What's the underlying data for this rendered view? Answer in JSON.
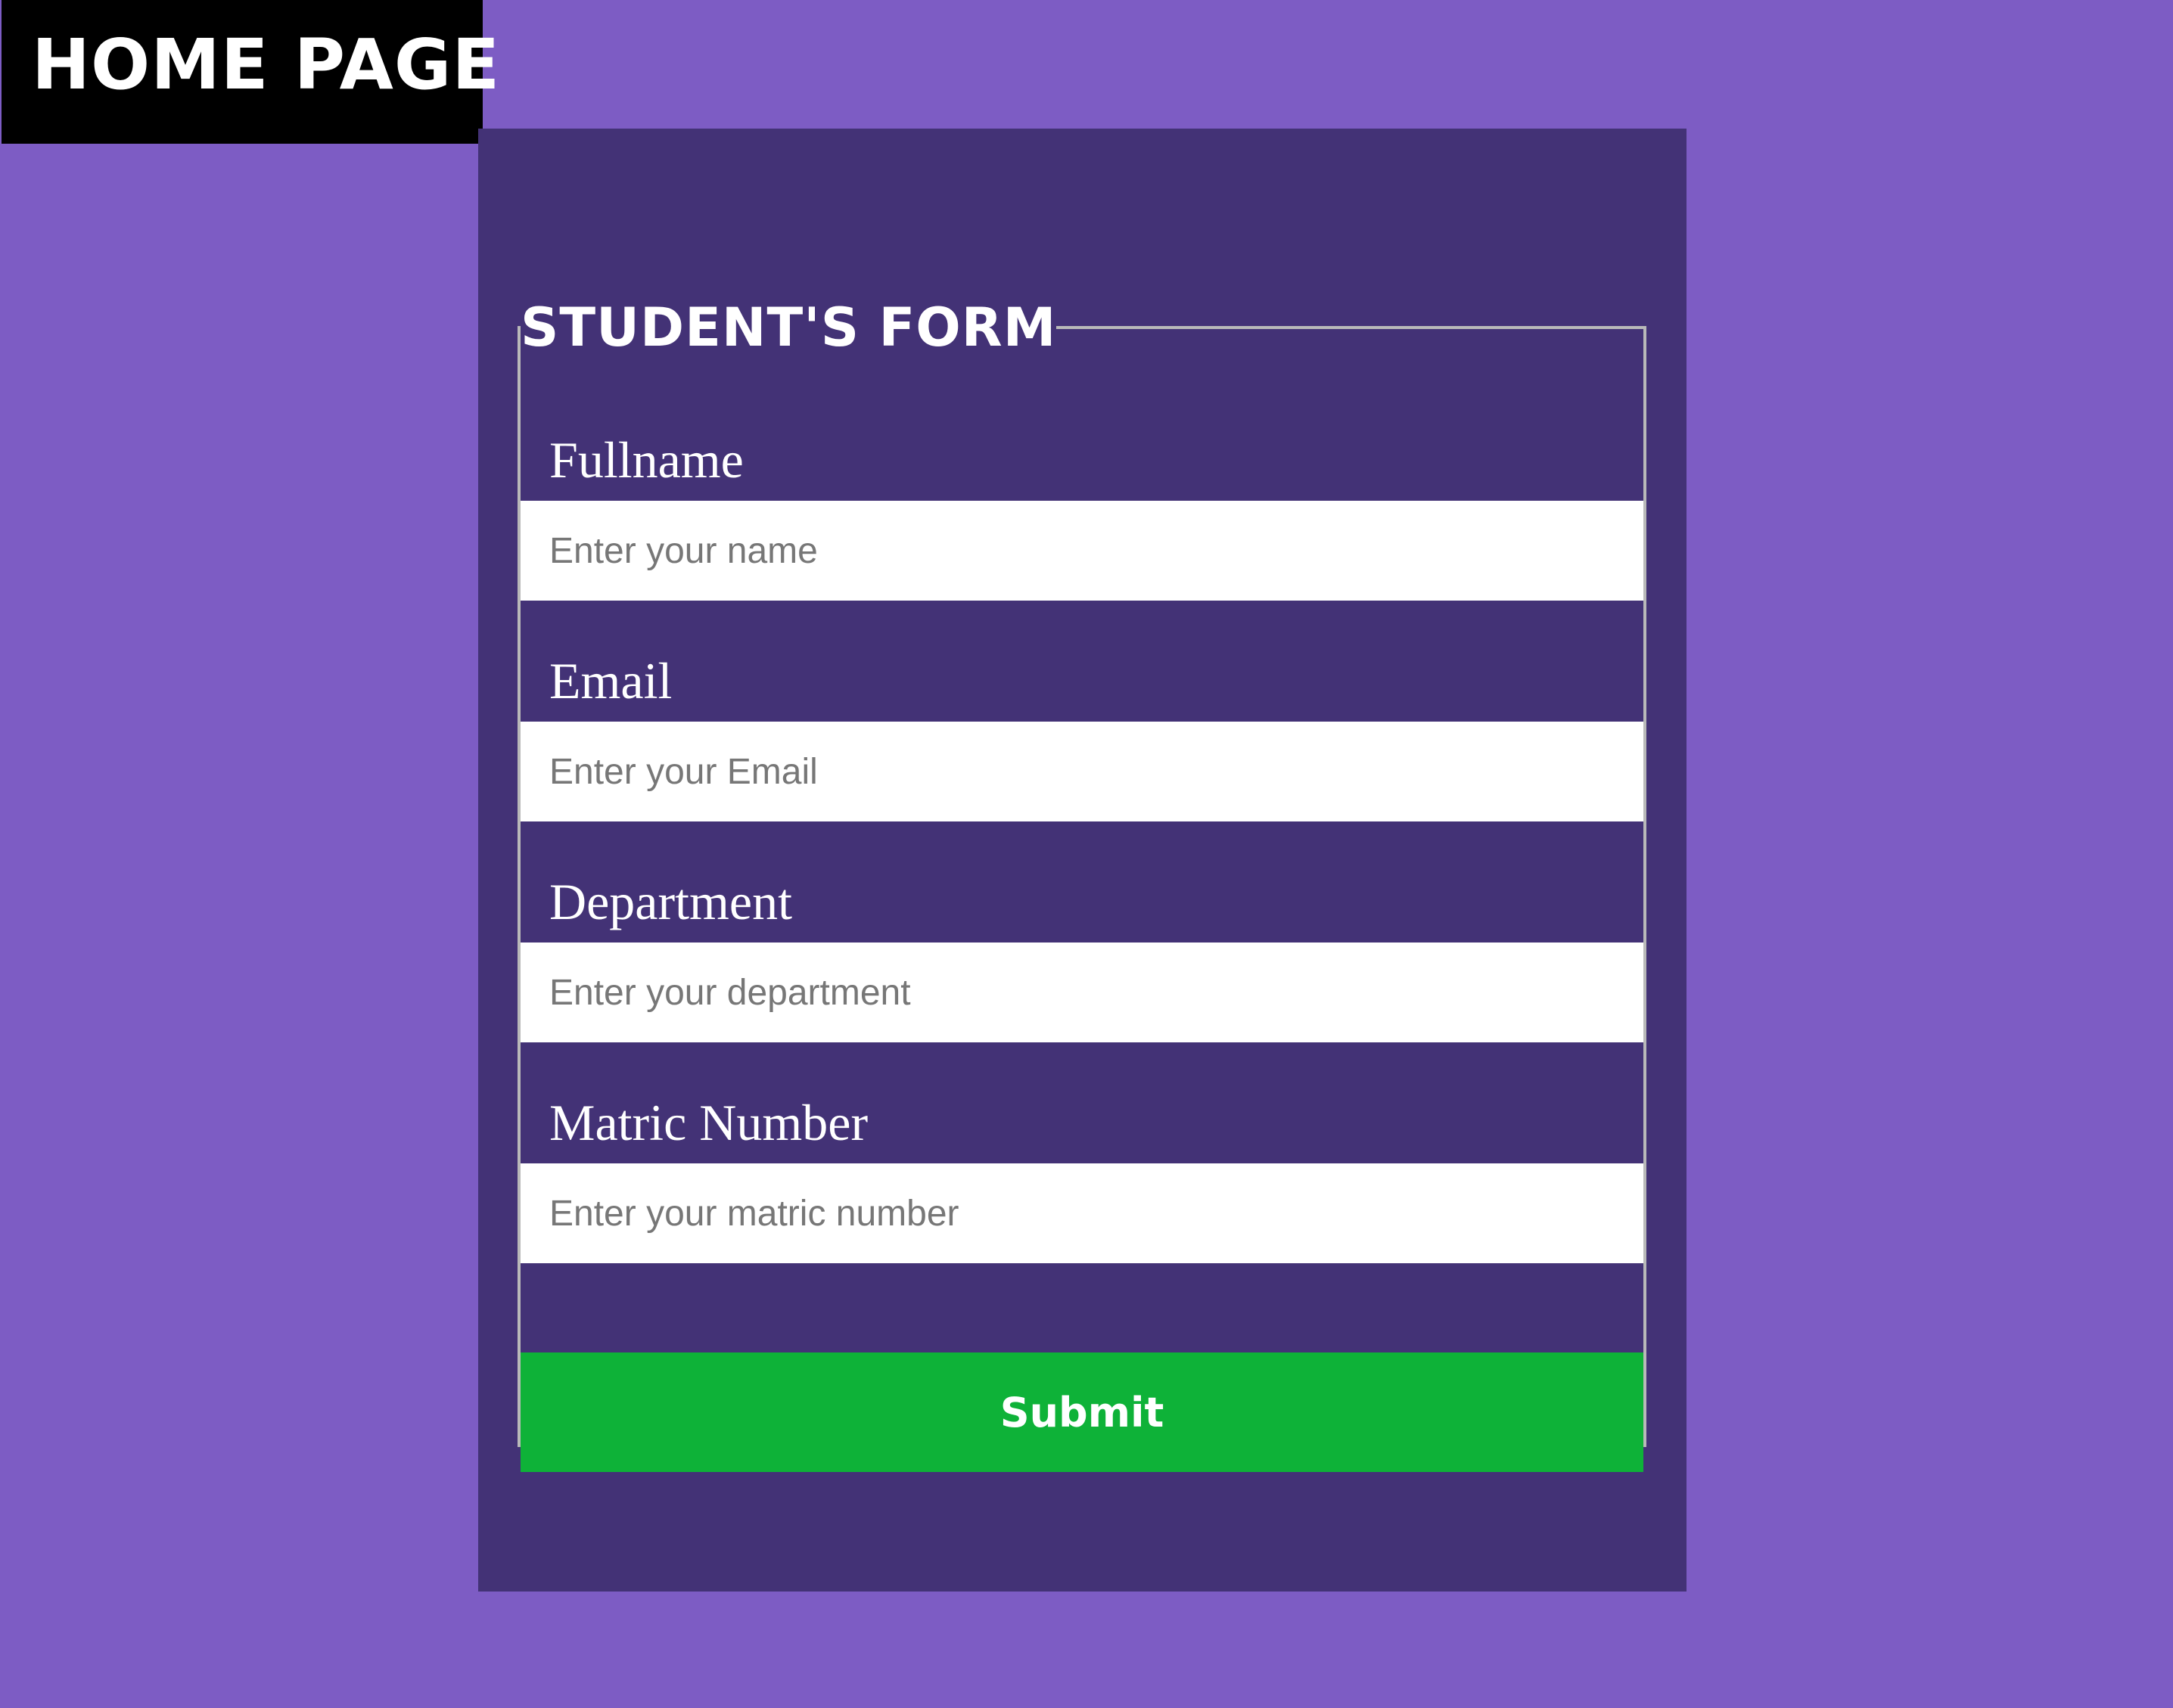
{
  "header": {
    "home_label": "HOME PAGE"
  },
  "form": {
    "title": "STUDENT'S FORM",
    "fields": [
      {
        "label": "Fullname",
        "placeholder": "Enter your name",
        "value": ""
      },
      {
        "label": "Email",
        "placeholder": "Enter your Email",
        "value": ""
      },
      {
        "label": "Department",
        "placeholder": "Enter your department",
        "value": ""
      },
      {
        "label": "Matric Number",
        "placeholder": "Enter your matric number",
        "value": ""
      }
    ],
    "submit_label": "Submit"
  },
  "colors": {
    "page_background": "#7d5cc4",
    "panel_background": "#433276",
    "header_background": "#000000",
    "submit_background": "#0eb238",
    "fieldset_border": "#b9b9b9"
  }
}
